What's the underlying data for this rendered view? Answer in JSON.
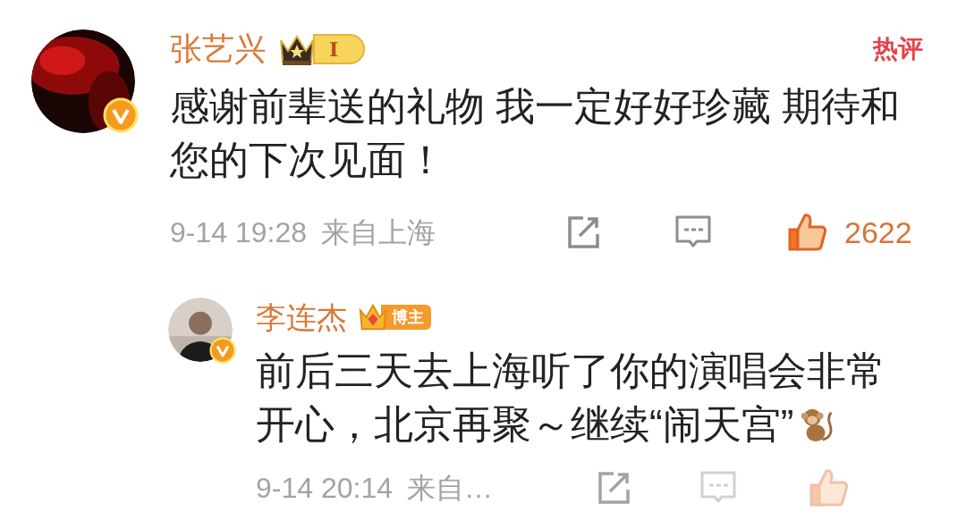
{
  "comments": [
    {
      "author": "张艺兴",
      "verified": true,
      "badge": {
        "kind": "crown-level",
        "text": "I"
      },
      "hot_label": "热评",
      "text": "感谢前辈送的礼物 我一定好好珍藏 期待和您的下次见面！",
      "time": "9-14 19:28",
      "location": "来自上海",
      "likes": "2622",
      "liked": true,
      "replies": [
        {
          "author": "李连杰",
          "verified": true,
          "badge": {
            "kind": "blogger",
            "text": "博主"
          },
          "text": "前后三天去上海听了你的演唱会非常开心，北京再聚～继续“闹天宫”",
          "time": "9-14 20:14",
          "location": "来自…",
          "liked": true
        }
      ]
    }
  ]
}
